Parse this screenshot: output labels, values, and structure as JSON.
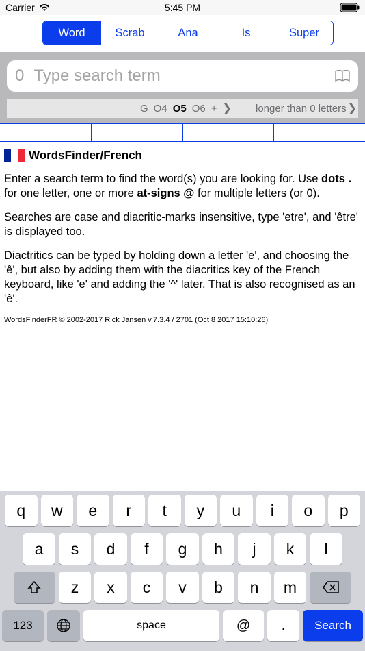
{
  "status": {
    "carrier": "Carrier",
    "time": "5:45 PM"
  },
  "tabs": {
    "t0": "Word",
    "t1": "Scrab",
    "t2": "Ana",
    "t3": "Is",
    "t4": "Super"
  },
  "search": {
    "count": "0",
    "placeholder": "Type search term"
  },
  "filters": {
    "g": "G",
    "o4": "O4",
    "o5": "O5",
    "o6": "O6",
    "plus": "+",
    "right": "longer than 0 letters"
  },
  "title": "WordsFinder/French",
  "p1_a": "Enter a search term to find the word(s) you are looking for. Use ",
  "p1_b": "dots . ",
  "p1_c": "for one letter, one or more ",
  "p1_d": "at-signs @ ",
  "p1_e": "for multiple letters (or 0).",
  "p2": "Searches are case and diacritic-marks insensitive, type 'etre', and 'être' is displayed too.",
  "p3": "Diactritics can be typed by holding down a letter 'e', and choosing the 'ê', but also by adding them with the diacritics key of the French keyboard, like 'e' and adding the '^' later. That is also recognised as an 'ê'.",
  "copyright": "WordsFinderFR © 2002-2017 Rick Jansen v.7.3.4 / 2701 (Oct 8 2017 15:10:26)",
  "keys": {
    "r1": [
      "q",
      "w",
      "e",
      "r",
      "t",
      "y",
      "u",
      "i",
      "o",
      "p"
    ],
    "r2": [
      "a",
      "s",
      "d",
      "f",
      "g",
      "h",
      "j",
      "k",
      "l"
    ],
    "r3": [
      "z",
      "x",
      "c",
      "v",
      "b",
      "n",
      "m"
    ],
    "num": "123",
    "space": "space",
    "at": "@",
    "dot": ".",
    "search": "Search"
  }
}
